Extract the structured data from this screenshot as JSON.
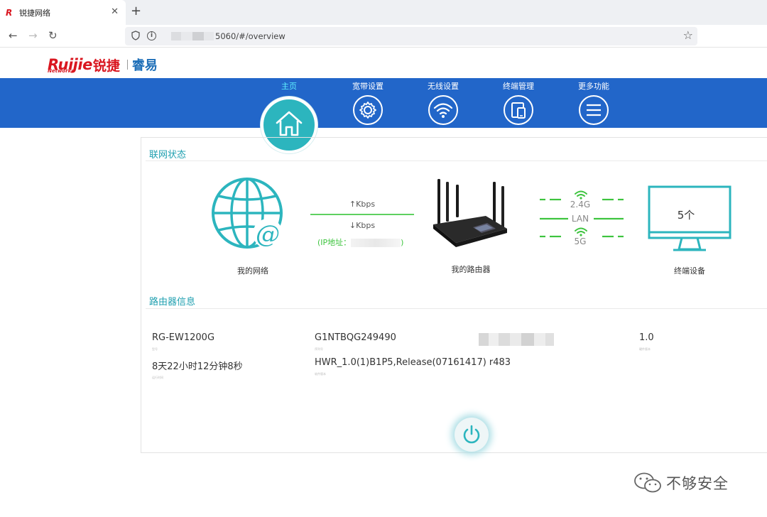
{
  "browser": {
    "tab_title": "锐捷网络",
    "tab_favicon": "R",
    "new_tab_symbol": "+",
    "close_symbol": "✕",
    "url_text": "5060/#/overview",
    "back_icon": "←",
    "forward_icon": "→",
    "reload_icon": "↻",
    "star_icon": "☆"
  },
  "logo": {
    "brand": "Ruijie",
    "brand_cn": "锐捷",
    "networks": "Networks",
    "product": "睿易"
  },
  "menu": [
    {
      "label": "主页",
      "icon": "home-icon",
      "active": true
    },
    {
      "label": "宽带设置",
      "icon": "gear-icon",
      "active": false
    },
    {
      "label": "无线设置",
      "icon": "wifi-icon",
      "active": false
    },
    {
      "label": "终端管理",
      "icon": "devices-icon",
      "active": false
    },
    {
      "label": "更多功能",
      "icon": "menu-icon",
      "active": false
    }
  ],
  "status": {
    "section_title": "联网状态",
    "my_network": "我的网络",
    "upload": "↑Kbps",
    "download": "↓Kbps",
    "ip_prefix": "(IP地址：",
    "ip_suffix": ")",
    "my_router": "我的路由器",
    "band_24": "2.4G",
    "lan": "LAN",
    "band_5": "5G",
    "device_count": "5个",
    "devices_label": "终端设备"
  },
  "router_info": {
    "section_title": "路由器信息",
    "model": "RG-EW1200G",
    "model_label": "型号",
    "serial": "G1NTBQG249490",
    "serial_label": "序列号",
    "hardware_version": "1.0",
    "hardware_version_label": "硬件版本",
    "uptime": "8天22小时12分钟8秒",
    "uptime_label": "运行时间",
    "software_version": "HWR_1.0(1)B1P5,Release(07161417) r483",
    "software_version_label": "软件版本"
  },
  "watermark": {
    "text": "不够安全"
  },
  "colors": {
    "nav_blue": "#2266c9",
    "teal": "#2cb5be",
    "green": "#3ec43f",
    "brand_red": "#d9161f"
  }
}
